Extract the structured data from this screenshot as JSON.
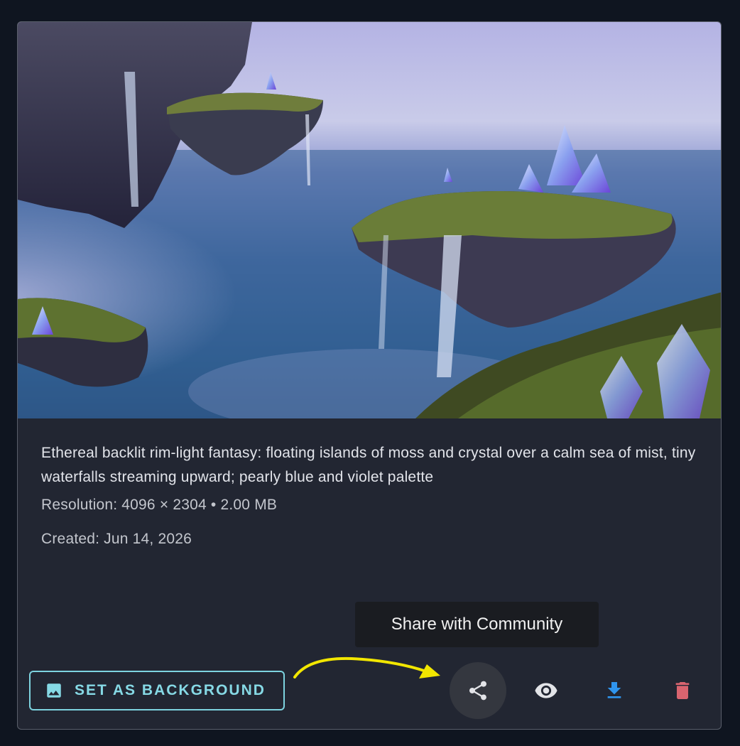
{
  "card": {
    "description": "Ethereal backlit rim-light fantasy: floating islands of moss and crystal over a calm sea of mist, tiny waterfalls streaming upward; pearly blue and violet palette",
    "resolution": "Resolution: 4096 × 2304 • 2.00 MB",
    "created": "Created: Jun 14, 2026"
  },
  "tooltip": {
    "text": "Share with Community"
  },
  "actions": {
    "set_background_label": "SET AS BACKGROUND",
    "icons": [
      "image-icon",
      "share-icon",
      "eye-icon",
      "download-icon",
      "trash-icon"
    ]
  },
  "colors": {
    "page_bg": "#0f1520",
    "card_bg": "#222632",
    "accent_cyan": "#86d9e5",
    "download_blue": "#2f95ee",
    "delete_red": "#d9646f",
    "annotation_arrow": "#f2e600"
  }
}
